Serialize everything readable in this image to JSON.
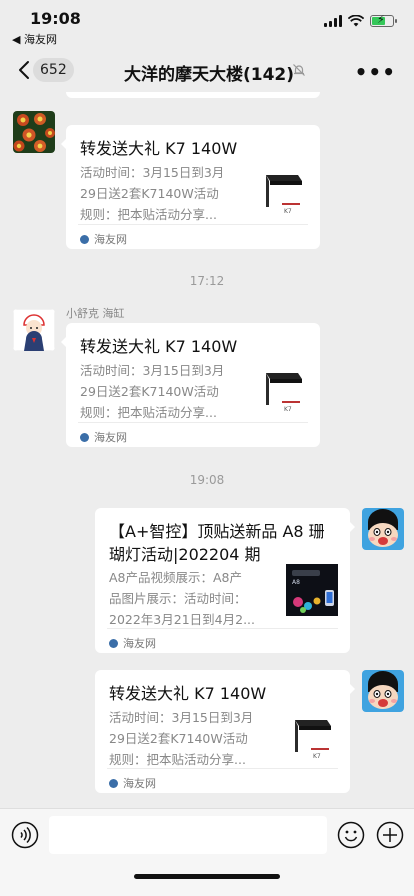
{
  "status": {
    "time": "19:08",
    "back_app": "◀ 海友网"
  },
  "nav": {
    "back_count": "652",
    "title": "大洋的摩天大楼(142)",
    "more": "•••"
  },
  "timestamps": [
    "17:12",
    "19:08"
  ],
  "messages": [
    {
      "sender": "",
      "title": "转发送大礼  K7 140W",
      "description": [
        "活动时间：3月15日到3月",
        "29日送2套K7140W活动",
        "规则：把本贴活动分享..."
      ],
      "source": "海友网",
      "thumb_icon": "k7-lamp-thumbnail"
    },
    {
      "sender": "小舒克 海缸",
      "title": "转发送大礼  K7 140W",
      "description": [
        "活动时间：3月15日到3月",
        "29日送2套K7140W活动",
        "规则：把本贴活动分享..."
      ],
      "source": "海友网",
      "thumb_icon": "k7-lamp-thumbnail"
    },
    {
      "sender": "",
      "title": [
        "【A+智控】顶贴送新品 A8 珊",
        "瑚灯活动|202204 期"
      ],
      "description": [
        "A8产品视频展示：A8产",
        "品图片展示：活动时间：",
        "2022年3月21日到4月2..."
      ],
      "source": "海友网",
      "thumb_icon": "a8-coral-light-thumbnail"
    },
    {
      "sender": "",
      "title": "转发送大礼  K7 140W",
      "description": [
        "活动时间：3月15日到3月",
        "29日送2套K7140W活动",
        "规则：把本贴活动分享..."
      ],
      "source": "海友网",
      "thumb_icon": "k7-lamp-thumbnail"
    }
  ],
  "input": {
    "placeholder": ""
  },
  "colors": {
    "background": "#ededed",
    "bubble": "#ffffff",
    "battery": "#35c759",
    "meta_text": "#9a9a9a"
  }
}
